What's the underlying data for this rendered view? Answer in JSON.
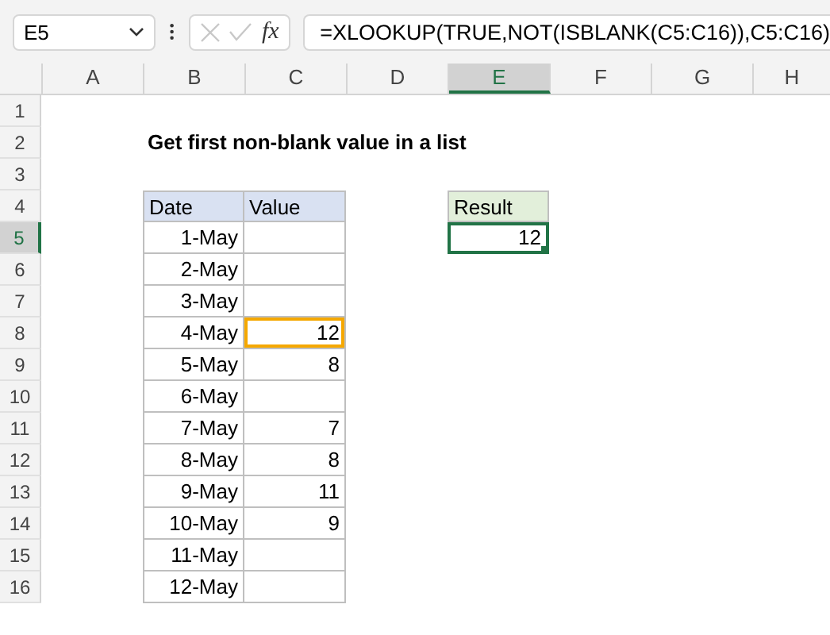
{
  "name_box": {
    "value": "E5"
  },
  "formula_bar": {
    "fx": "fx",
    "formula": "=XLOOKUP(TRUE,NOT(ISBLANK(C5:C16)),C5:C16)"
  },
  "columns": [
    {
      "label": "A",
      "selected": false
    },
    {
      "label": "B",
      "selected": false
    },
    {
      "label": "C",
      "selected": false
    },
    {
      "label": "D",
      "selected": false
    },
    {
      "label": "E",
      "selected": true
    },
    {
      "label": "F",
      "selected": false
    },
    {
      "label": "G",
      "selected": false
    },
    {
      "label": "H",
      "selected": false
    }
  ],
  "rows": [
    {
      "label": "1",
      "selected": false
    },
    {
      "label": "2",
      "selected": false
    },
    {
      "label": "3",
      "selected": false
    },
    {
      "label": "4",
      "selected": false
    },
    {
      "label": "5",
      "selected": true
    },
    {
      "label": "6",
      "selected": false
    },
    {
      "label": "7",
      "selected": false
    },
    {
      "label": "8",
      "selected": false
    },
    {
      "label": "9",
      "selected": false
    },
    {
      "label": "10",
      "selected": false
    },
    {
      "label": "11",
      "selected": false
    },
    {
      "label": "12",
      "selected": false
    },
    {
      "label": "13",
      "selected": false
    },
    {
      "label": "14",
      "selected": false
    },
    {
      "label": "15",
      "selected": false
    },
    {
      "label": "16",
      "selected": false
    }
  ],
  "title": "Get first non-blank value in a list",
  "data_table": {
    "headers": [
      "Date",
      "Value"
    ],
    "rows": [
      {
        "date": "1-May",
        "highlighted": false
      },
      {
        "date": "2-May",
        "highlighted": false
      },
      {
        "date": "3-May",
        "highlighted": false
      },
      {
        "date": "4-May",
        "value": "12",
        "highlighted": true
      },
      {
        "date": "5-May",
        "value": "8",
        "highlighted": false
      },
      {
        "date": "6-May",
        "highlighted": false
      },
      {
        "date": "7-May",
        "value": "7",
        "highlighted": false
      },
      {
        "date": "8-May",
        "value": "8",
        "highlighted": false
      },
      {
        "date": "9-May",
        "value": "11",
        "highlighted": false
      },
      {
        "date": "10-May",
        "value": "9",
        "highlighted": false
      },
      {
        "date": "11-May",
        "highlighted": false
      },
      {
        "date": "12-May",
        "highlighted": false
      }
    ]
  },
  "result": {
    "header": "Result",
    "value": "12",
    "selected": true
  }
}
